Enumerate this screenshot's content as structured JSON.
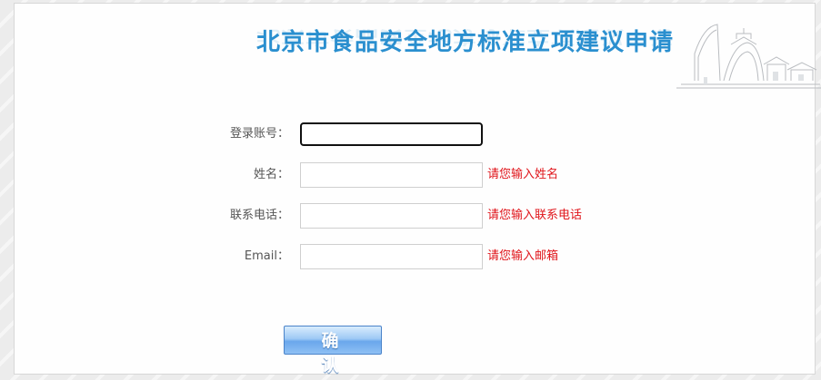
{
  "header": {
    "title": "北京市食品安全地方标准立项建议申请"
  },
  "form": {
    "account": {
      "label": "登录账号：",
      "value": "",
      "hint": ""
    },
    "name": {
      "label": "姓名：",
      "value": "",
      "hint": "请您输入姓名"
    },
    "phone": {
      "label": "联系电话：",
      "value": "",
      "hint": "请您输入联系电话"
    },
    "email": {
      "label": "Email：",
      "value": "",
      "hint": "请您输入邮箱"
    }
  },
  "actions": {
    "confirm_label": "确 认"
  },
  "colors": {
    "title": "#2a8fcf",
    "hint": "#e0141a",
    "button": "#6aa7ec"
  },
  "icons": {
    "skyline": "beijing-skyline-decoration"
  }
}
